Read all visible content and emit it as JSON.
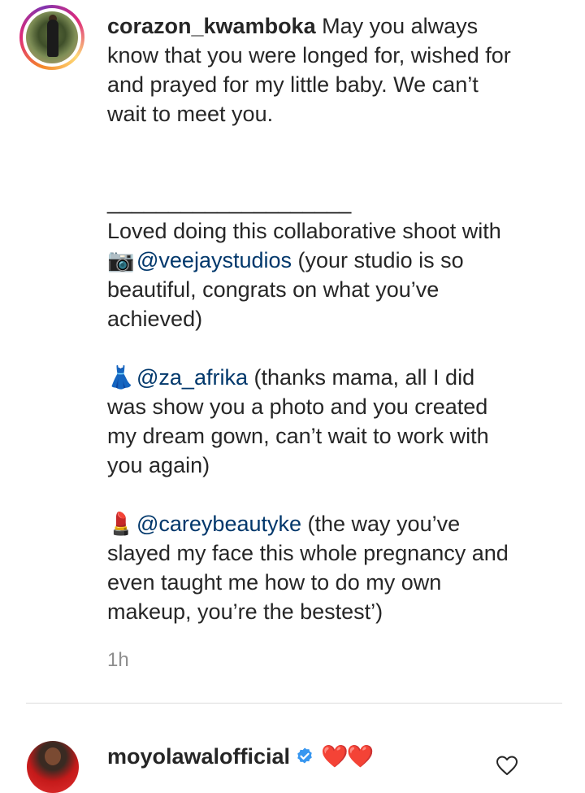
{
  "post": {
    "username": "corazon_kwamboka",
    "caption_intro": " May you always know that you were longed for, wished for and prayed for my little baby. We can’t wait to meet you.",
    "separator": "____________________",
    "collab_line": "Loved doing this collaborative shoot with",
    "credits": [
      {
        "emoji": "📷",
        "emoji_name": "camera-icon",
        "mention": "@veejaystudios",
        "note": " (your studio is so beautiful, congrats on what you’ve achieved)"
      },
      {
        "emoji": "👗",
        "emoji_name": "dress-icon",
        "mention": "@za_afrika",
        "note": " (thanks mama, all I did was show you a photo and you created my dream gown, can’t wait to work with you again)"
      },
      {
        "emoji": "💄",
        "emoji_name": "lipstick-icon",
        "mention": "@careybeautyke",
        "note": " (the way you’ve slayed my face this whole pregnancy and even taught me how to do my own makeup, you’re the bestest’)"
      }
    ],
    "timestamp": "1h"
  },
  "comment": {
    "username": "moyolawalofficial",
    "verified": true,
    "text": "❤️❤️",
    "like_icon": "heart-outline-icon"
  },
  "colors": {
    "mention": "#00376b",
    "text": "#262626",
    "muted": "#8e8e8e",
    "verified_badge": "#3897f0",
    "heart": "#d0021b"
  }
}
